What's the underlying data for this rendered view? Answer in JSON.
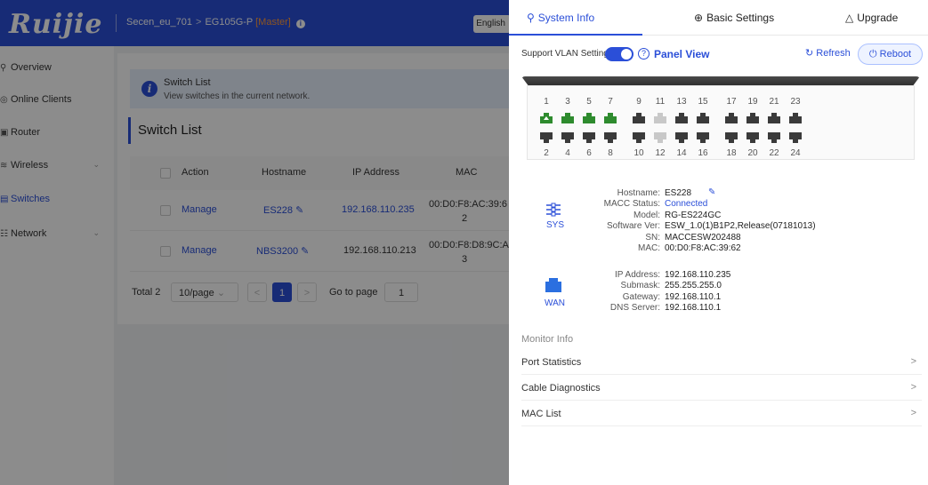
{
  "header": {
    "logo": "Ruijie",
    "breadcrumb": [
      "Secen_eu_701",
      "EG105G-P"
    ],
    "device_role": "[Master]",
    "language_button": "English"
  },
  "sidenav": {
    "items": [
      {
        "label": "Overview",
        "icon": "topology-icon",
        "active": false
      },
      {
        "label": "Online Clients",
        "icon": "clients-icon",
        "active": false
      },
      {
        "label": "Router",
        "icon": "router-icon",
        "active": false
      },
      {
        "label": "Wireless",
        "icon": "wifi-icon",
        "active": false,
        "expandable": true
      },
      {
        "label": "Switches",
        "icon": "switch-icon",
        "active": true
      },
      {
        "label": "Network",
        "icon": "network-icon",
        "active": false,
        "expandable": true
      }
    ]
  },
  "main": {
    "notice_title": "Switch List",
    "notice_desc": "View switches in the current network.",
    "section_title": "Switch List",
    "columns": [
      "Action",
      "Hostname",
      "IP Address",
      "MAC"
    ],
    "rows": [
      {
        "action": "Manage",
        "hostname": "ES228",
        "ip": "192.168.110.235",
        "mac_line1": "00:D0:F8:AC:39:6",
        "mac_line2": "2"
      },
      {
        "action": "Manage",
        "hostname": "NBS3200",
        "ip": "192.168.110.213",
        "mac_line1": "00:D0:F8:D8:9C:A",
        "mac_line2": "3"
      }
    ],
    "pager": {
      "total": "Total 2",
      "page_size": "10/page",
      "current_page": "1",
      "goto_label": "Go to page",
      "goto_value": "1"
    }
  },
  "drawer": {
    "tabs": [
      {
        "label": "System Info",
        "icon": "topology-icon",
        "active": true
      },
      {
        "label": "Basic Settings",
        "icon": "globe-icon",
        "active": false
      },
      {
        "label": "Upgrade",
        "icon": "cloud-icon",
        "active": false
      }
    ],
    "vlan_label": "Support VLAN Settings",
    "vlan_enabled": true,
    "panel_view": "Panel View",
    "refresh": "Refresh",
    "reboot": "Reboot",
    "ports": {
      "top_numbers": [
        "1",
        "3",
        "5",
        "7",
        "9",
        "11",
        "13",
        "15",
        "17",
        "19",
        "21",
        "23"
      ],
      "bottom_numbers": [
        "2",
        "4",
        "6",
        "8",
        "10",
        "12",
        "14",
        "16",
        "18",
        "20",
        "22",
        "24"
      ],
      "top_states": [
        "uplink",
        "up",
        "up",
        "up",
        "down",
        "idle",
        "down",
        "down",
        "down",
        "down",
        "down",
        "down"
      ],
      "bottom_states": [
        "down",
        "down",
        "down",
        "down",
        "down",
        "idle",
        "down",
        "down",
        "down",
        "down",
        "down",
        "down"
      ],
      "colors": {
        "up": "#2e8b2e",
        "down": "#3a3a3a",
        "idle": "#c8c8c8"
      }
    },
    "sys": {
      "label": "SYS",
      "fields": [
        {
          "key": "Hostname:",
          "value": "ES228",
          "blue": false,
          "editable": true
        },
        {
          "key": "MACC Status:",
          "value": "Connected",
          "blue": true
        },
        {
          "key": "Model:",
          "value": "RG-ES224GC",
          "blue": false
        },
        {
          "key": "Software Ver:",
          "value": "ESW_1.0(1)B1P2,Release(07181013)",
          "blue": false
        },
        {
          "key": "SN:",
          "value": "MACCESW202488",
          "blue": false
        },
        {
          "key": "MAC:",
          "value": "00:D0:F8:AC:39:62",
          "blue": false
        }
      ]
    },
    "wan": {
      "label": "WAN",
      "fields": [
        {
          "key": "IP Address:",
          "value": "192.168.110.235"
        },
        {
          "key": "Submask:",
          "value": "255.255.255.0"
        },
        {
          "key": "Gateway:",
          "value": "192.168.110.1"
        },
        {
          "key": "DNS Server:",
          "value": "192.168.110.1"
        }
      ]
    },
    "monitor_title": "Monitor Info",
    "menu": [
      "Port Statistics",
      "Cable Diagnostics",
      "MAC List"
    ]
  }
}
